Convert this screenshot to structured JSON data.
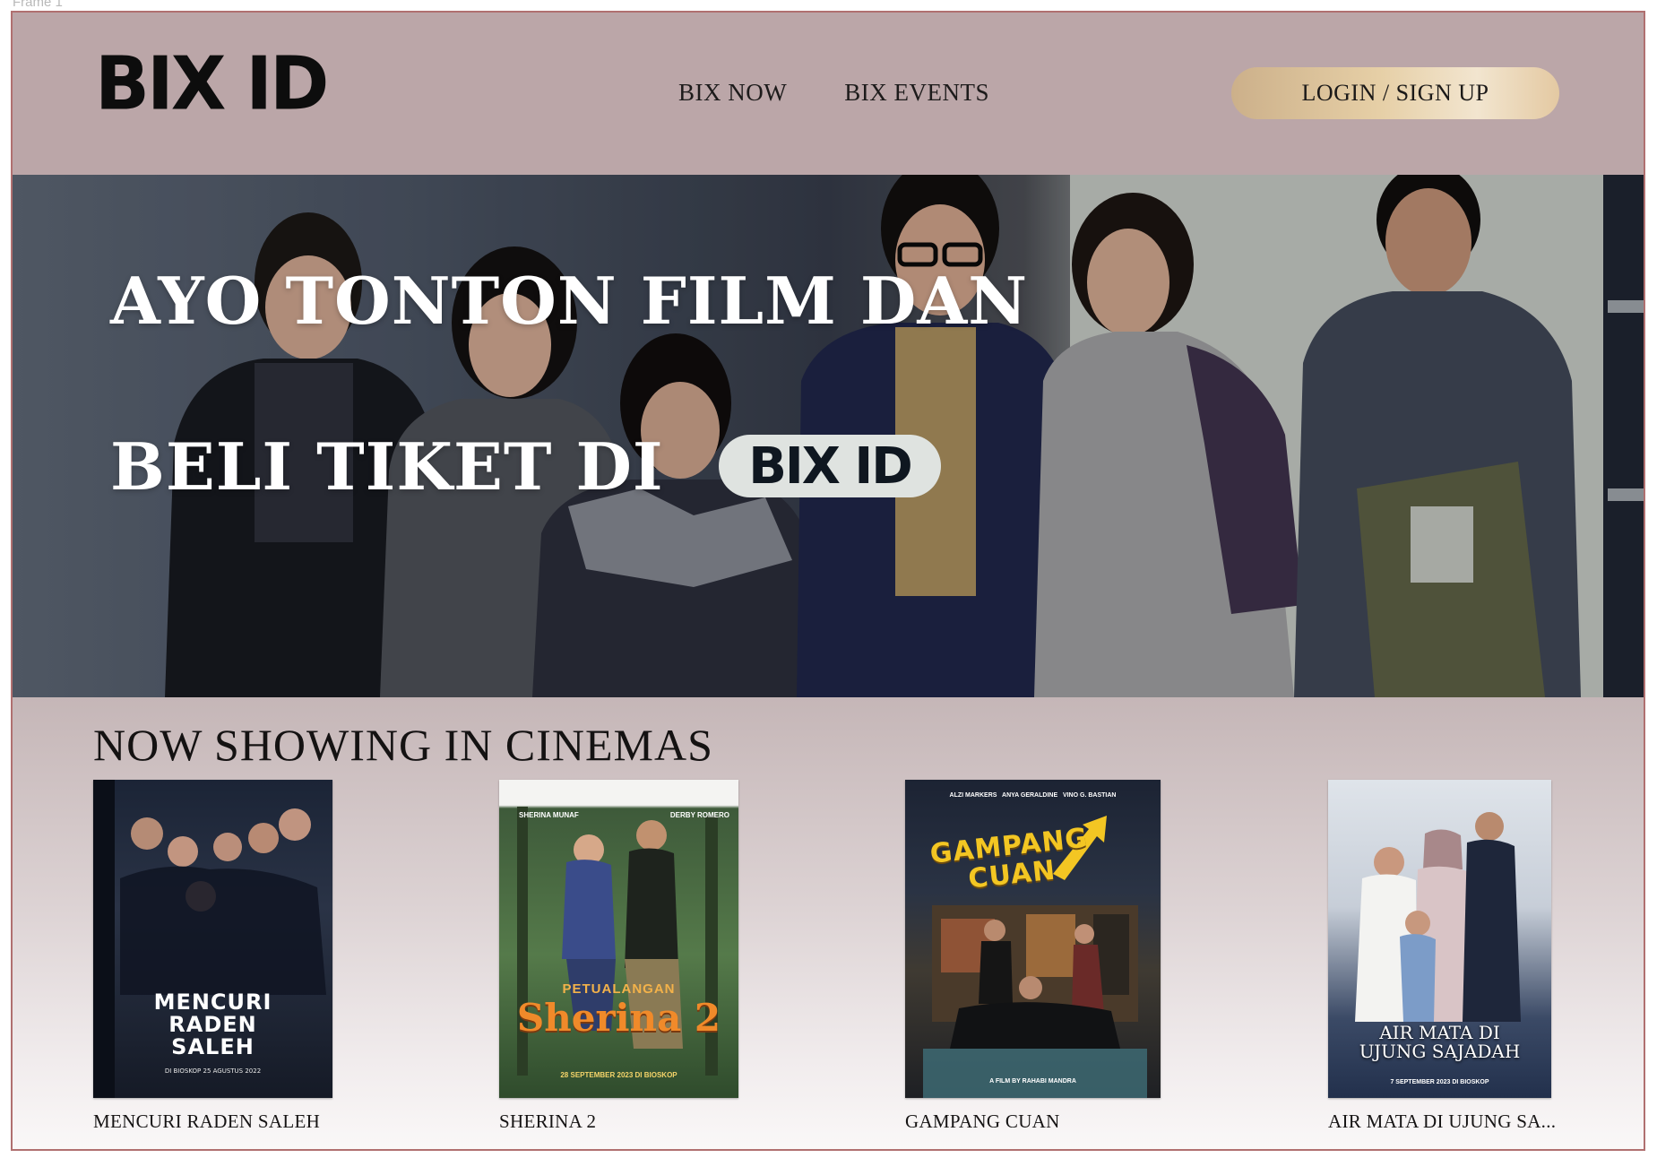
{
  "header": {
    "logo": "BIX ID",
    "nav": [
      "BIX NOW",
      "BIX EVENTS"
    ],
    "login_label": "LOGIN / SIGN UP"
  },
  "hero": {
    "line1": "AYO TONTON FILM DAN",
    "line2": "BELI TIKET DI",
    "badge": "BIX ID"
  },
  "now_showing": {
    "title": "NOW SHOWING IN CINEMAS",
    "movies": [
      {
        "caption": "MENCURI RADEN SALEH",
        "poster_title": "MENCURI RADEN SALEH",
        "poster_release": "DI BIOSKOP 25 AGUSTUS 2022"
      },
      {
        "caption": "SHERINA 2",
        "poster_title": "Sherina 2",
        "poster_kicker": "PETUALANGAN",
        "poster_release": "28 SEPTEMBER 2023 DI BIOSKOP",
        "poster_cast_left": "Sherina Munaf",
        "poster_cast_right": "Derby Romero"
      },
      {
        "caption": "GAMPANG CUAN",
        "poster_title": "GAMPANG CUAN",
        "poster_release": "A FILM BY RAHABI MANDRA",
        "poster_cast": "ALZI MARKERS   ANYA GERALDINE   VINO G. BASTIAN"
      },
      {
        "caption": "AIR MATA DI UJUNG SA...",
        "poster_title": "AIR MATA di UJUNG SAJADAH",
        "poster_release": "7 SEPTEMBER 2023 DI BIOSKOP"
      }
    ]
  },
  "colors": {
    "header_bg": "#bba6a8",
    "login_gold": "#e6cfa6",
    "frame_border": "#b07070"
  }
}
